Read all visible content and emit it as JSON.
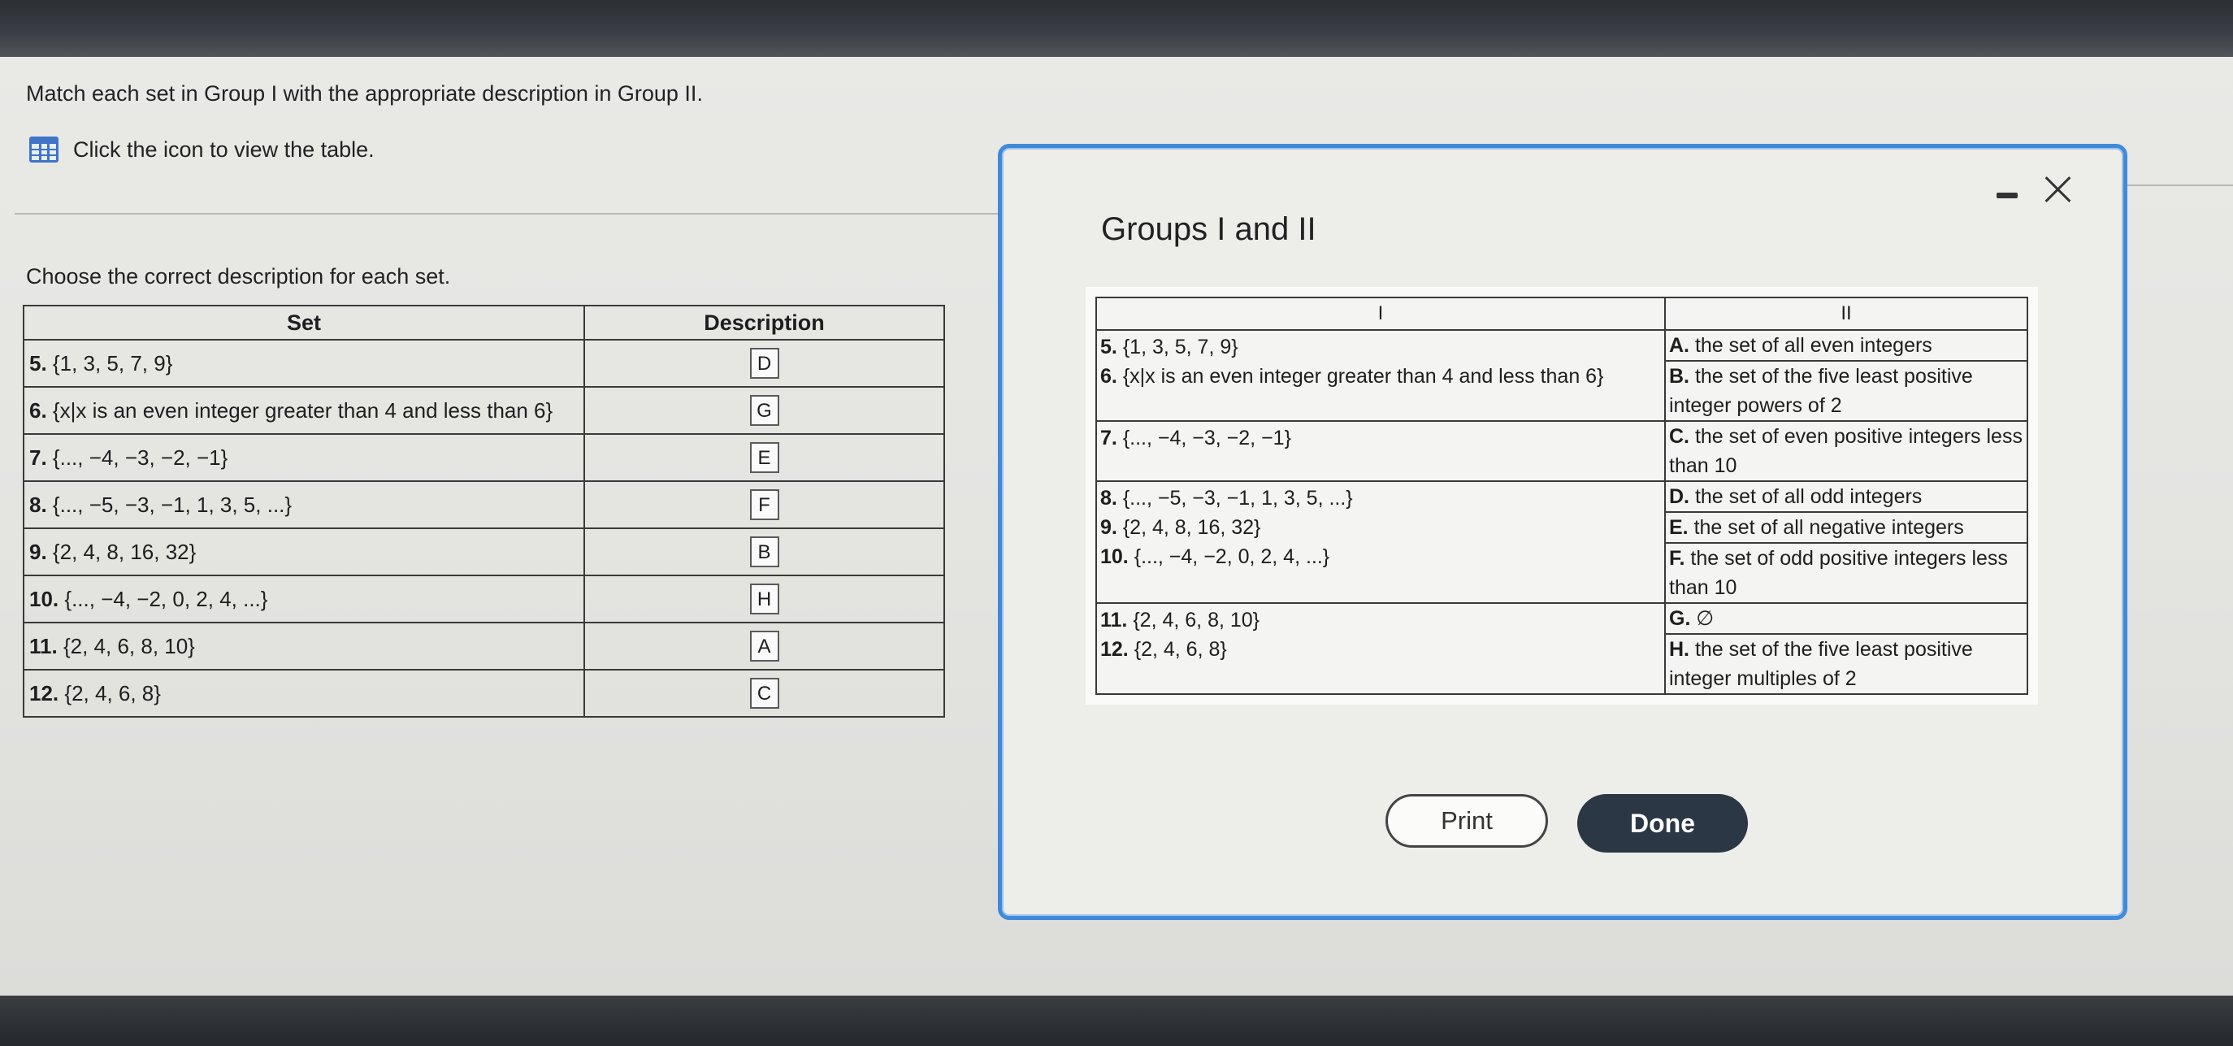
{
  "page": {
    "instruction": "Match each set in Group I with the appropriate description in Group II.",
    "table_link_label": "Click the icon to view the table.",
    "choose_prompt": "Choose the correct description for each set."
  },
  "answers_table": {
    "headers": {
      "set": "Set",
      "description": "Description"
    },
    "rows": [
      {
        "num": "5.",
        "set": "{1, 3, 5, 7, 9}",
        "answer": "D"
      },
      {
        "num": "6.",
        "set": "{x|x is an even integer greater than 4 and less than 6}",
        "answer": "G"
      },
      {
        "num": "7.",
        "set": "{..., −4, −3, −2, −1}",
        "answer": "E"
      },
      {
        "num": "8.",
        "set": "{..., −5, −3, −1, 1, 3, 5, ...}",
        "answer": "F"
      },
      {
        "num": "9.",
        "set": "{2, 4, 8, 16, 32}",
        "answer": "B"
      },
      {
        "num": "10.",
        "set": "{..., −4, −2, 0, 2, 4, ...}",
        "answer": "H"
      },
      {
        "num": "11.",
        "set": "{2, 4, 6, 8, 10}",
        "answer": "A"
      },
      {
        "num": "12.",
        "set": "{2, 4, 6, 8}",
        "answer": "C"
      }
    ]
  },
  "dialog": {
    "title": "Groups I and II",
    "minimize_icon": "minimize-icon",
    "close_icon": "close-icon",
    "headers": {
      "group1": "I",
      "group2": "II"
    },
    "blocks": [
      {
        "sets": [
          {
            "num": "5.",
            "set": "{1, 3, 5, 7, 9}"
          },
          {
            "num": "6.",
            "set": "{x|x is an even integer greater than 4 and less than 6}"
          }
        ],
        "descriptions": [
          {
            "letter": "A.",
            "text": "the set of all even integers"
          },
          {
            "letter": "B.",
            "text": "the set of the five least positive integer powers of 2"
          }
        ]
      },
      {
        "sets": [
          {
            "num": "7.",
            "set": "{..., −4, −3, −2, −1}"
          }
        ],
        "descriptions": [
          {
            "letter": "C.",
            "text": "the set of even positive integers less than 10"
          }
        ]
      },
      {
        "sets": [
          {
            "num": "8.",
            "set": "{..., −5, −3, −1, 1, 3, 5, ...}"
          },
          {
            "num": "9.",
            "set": "{2, 4, 8, 16, 32}"
          },
          {
            "num": "10.",
            "set": "{..., −4, −2, 0, 2, 4, ...}"
          }
        ],
        "descriptions": [
          {
            "letter": "D.",
            "text": "the set of all odd integers"
          },
          {
            "letter": "E.",
            "text": "the set of all negative integers"
          },
          {
            "letter": "F.",
            "text": "the set of odd positive integers less than 10"
          }
        ]
      },
      {
        "sets": [
          {
            "num": "11.",
            "set": "{2, 4, 6, 8, 10}"
          },
          {
            "num": "12.",
            "set": "{2, 4, 6, 8}"
          }
        ],
        "descriptions": [
          {
            "letter": "G.",
            "text": "∅"
          },
          {
            "letter": "H.",
            "text": "the set of the five least positive integer multiples of 2"
          }
        ]
      }
    ],
    "print_label": "Print",
    "done_label": "Done"
  },
  "colors": {
    "accent": "#3f8ad9",
    "done_button": "#2b3744",
    "icon": "#3f74c7"
  }
}
